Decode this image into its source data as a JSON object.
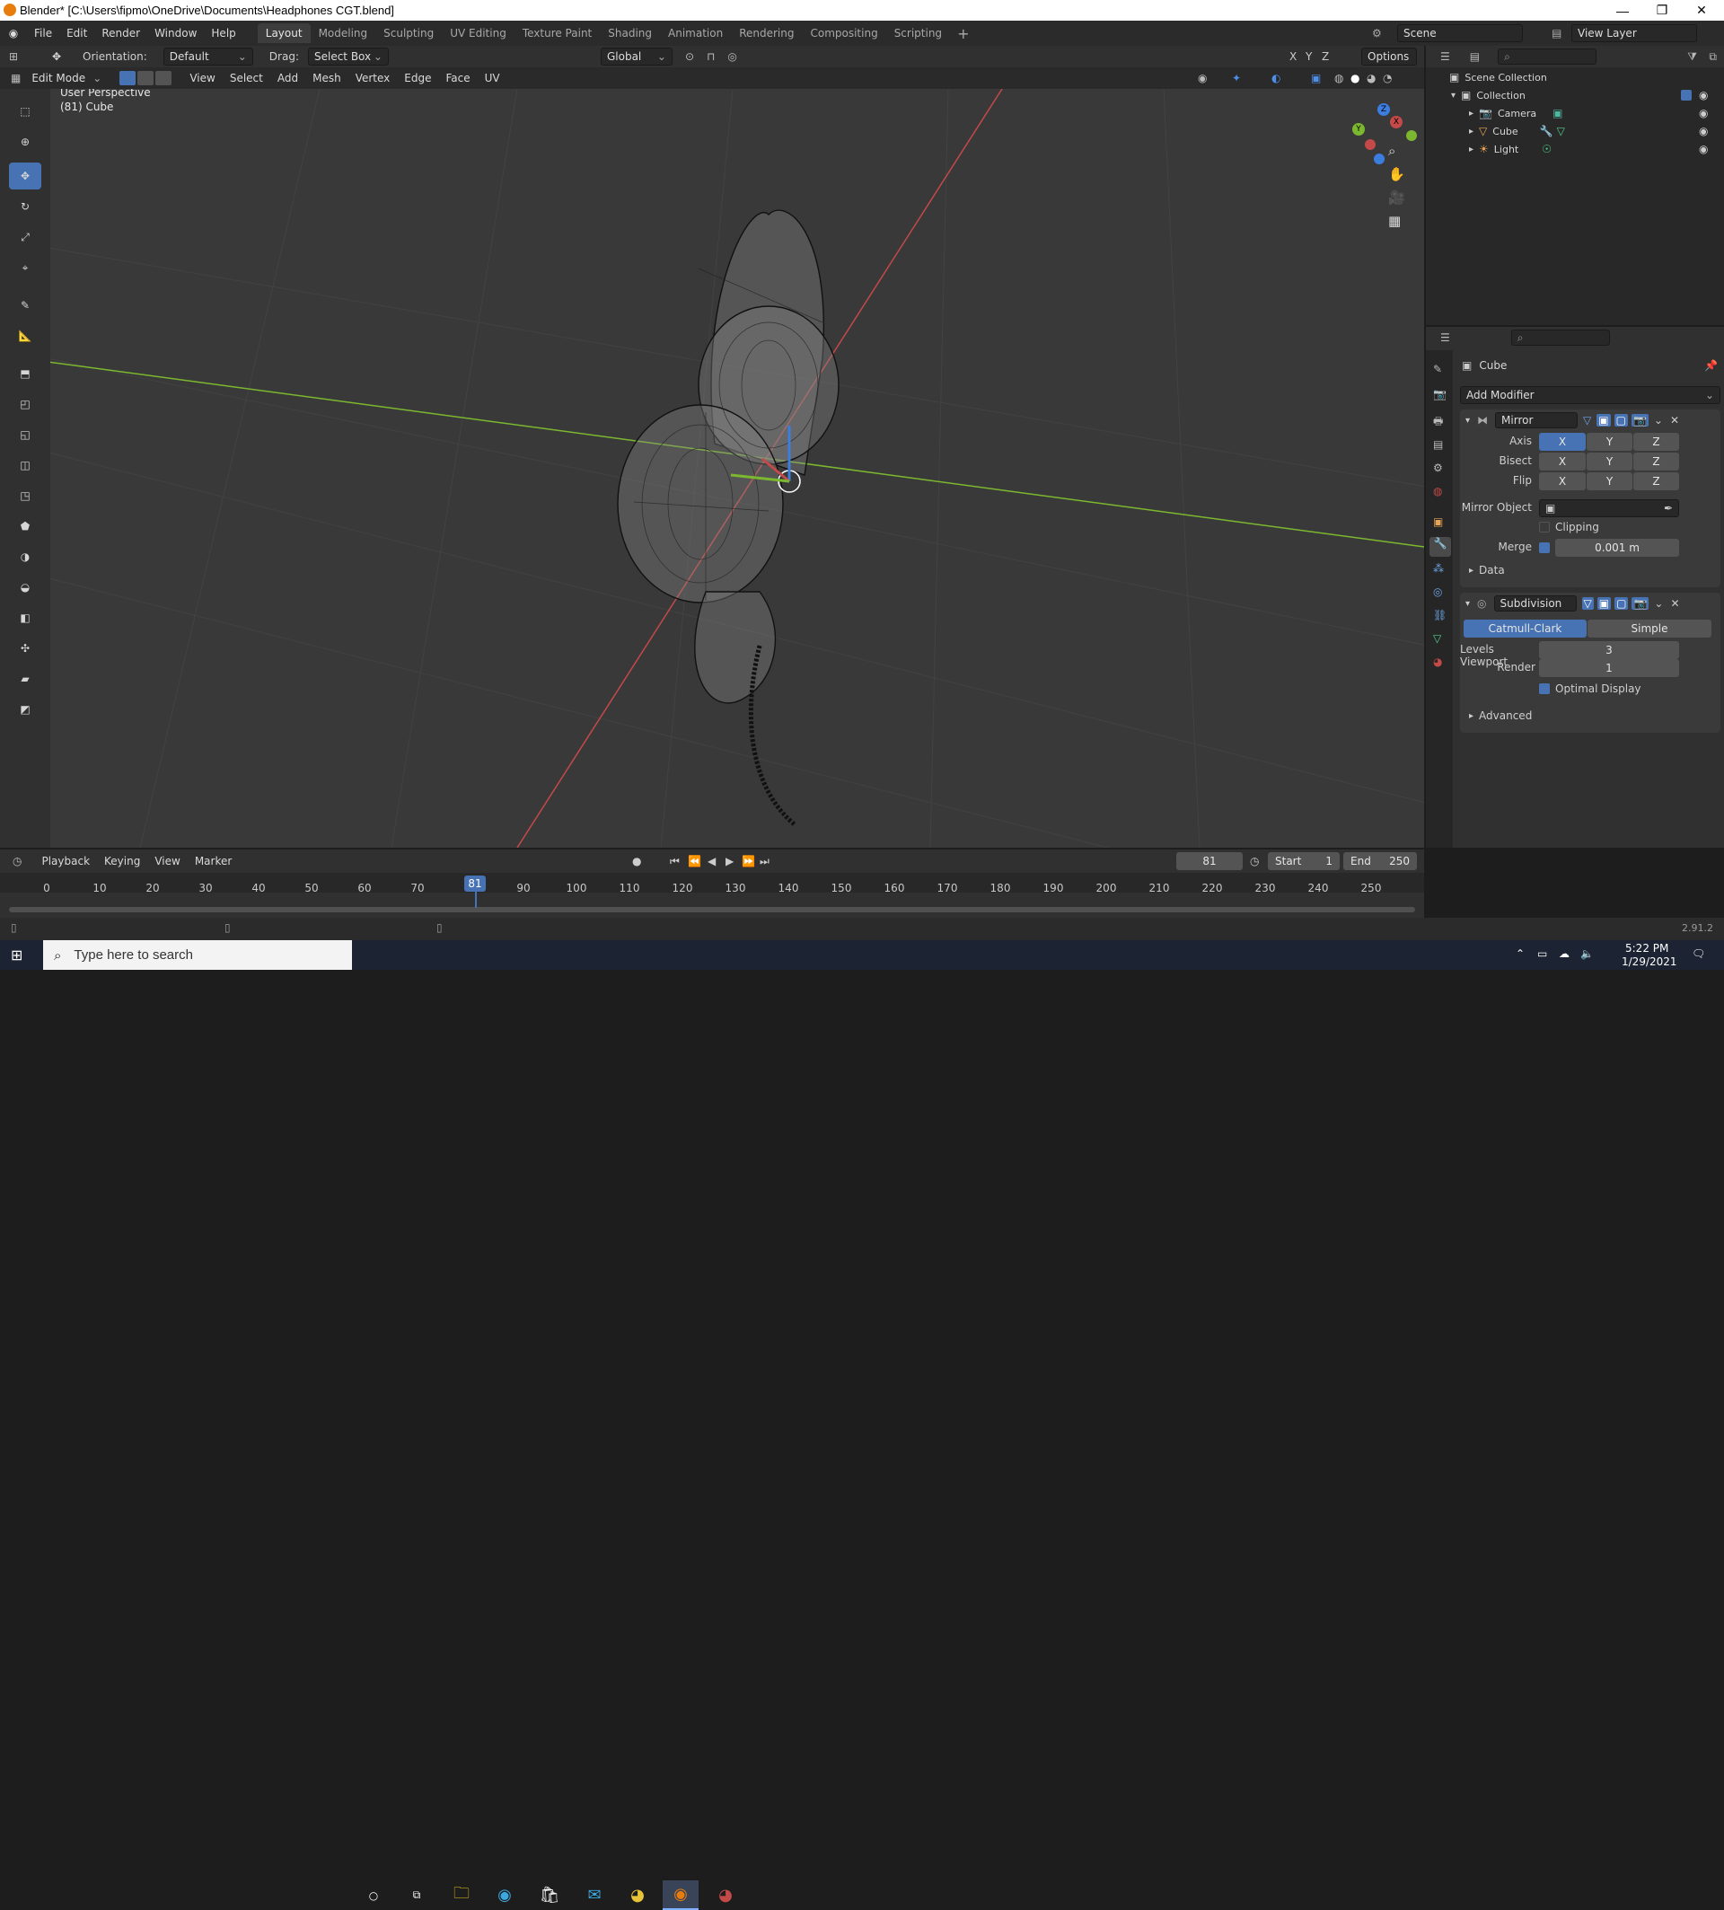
{
  "window": {
    "title": "Blender* [C:\\Users\\fipmo\\OneDrive\\Documents\\Headphones CGT.blend]",
    "controls": [
      "—",
      "❐",
      "✕"
    ]
  },
  "menu": [
    "File",
    "Edit",
    "Render",
    "Window",
    "Help"
  ],
  "workspaces": [
    "Layout",
    "Modeling",
    "Sculpting",
    "UV Editing",
    "Texture Paint",
    "Shading",
    "Animation",
    "Rendering",
    "Compositing",
    "Scripting"
  ],
  "active_workspace": "Layout",
  "scene": {
    "name": "Scene",
    "view_layer": "View Layer"
  },
  "tool_header": {
    "orientation_label": "Orientation:",
    "orientation_value": "Default",
    "drag_label": "Drag:",
    "drag_value": "Select Box",
    "transform_orientation": "Global",
    "axes": [
      "X",
      "Y",
      "Z"
    ],
    "options": "Options"
  },
  "viewport_header": {
    "mode": "Edit Mode",
    "menus": [
      "View",
      "Select",
      "Add",
      "Mesh",
      "Vertex",
      "Edge",
      "Face",
      "UV"
    ]
  },
  "viewport": {
    "perspective": "User Perspective",
    "object_info": "(81) Cube"
  },
  "outliner": {
    "root": "Scene Collection",
    "collection": "Collection",
    "items": [
      {
        "name": "Camera"
      },
      {
        "name": "Cube"
      },
      {
        "name": "Light"
      }
    ]
  },
  "properties": {
    "object_name": "Cube",
    "add_modifier": "Add Modifier",
    "mirror": {
      "name": "Mirror",
      "axis_label": "Axis",
      "bisect_label": "Bisect",
      "flip_label": "Flip",
      "axis": [
        "X",
        "Y",
        "Z"
      ],
      "mirror_object_label": "Mirror Object",
      "clipping_label": "Clipping",
      "merge_label": "Merge",
      "merge_value": "0.001 m",
      "data_label": "Data"
    },
    "subdivision": {
      "name": "Subdivision",
      "catmull": "Catmull-Clark",
      "simple": "Simple",
      "levels_viewport_label": "Levels Viewport",
      "levels_viewport": "3",
      "render_label": "Render",
      "render_value": "1",
      "optimal_display": "Optimal Display",
      "advanced_label": "Advanced"
    }
  },
  "timeline": {
    "menus": [
      "Playback",
      "Keying",
      "View",
      "Marker"
    ],
    "current_frame": "81",
    "start_label": "Start",
    "start": "1",
    "end_label": "End",
    "end": "250",
    "ticks": [
      "0",
      "10",
      "20",
      "30",
      "40",
      "50",
      "60",
      "70",
      "90",
      "100",
      "110",
      "120",
      "130",
      "140",
      "150",
      "160",
      "170",
      "180",
      "190",
      "200",
      "210",
      "220",
      "230",
      "240",
      "250"
    ]
  },
  "status": {
    "version": "2.91.2"
  },
  "taskbar": {
    "search_placeholder": "Type here to search",
    "time": "5:22 PM",
    "date": "1/29/2021"
  },
  "colors": {
    "accent": "#4772b3",
    "x_axis": "#c44949",
    "y_axis": "#7cb82f",
    "z_axis": "#3c7ee0"
  }
}
